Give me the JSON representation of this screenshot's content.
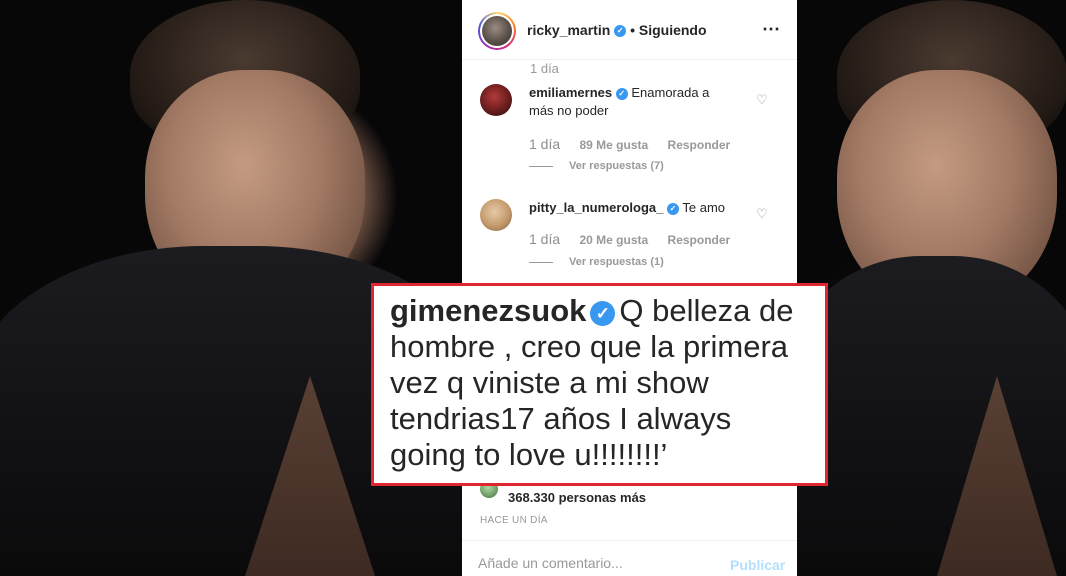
{
  "header": {
    "username": "ricky_martin",
    "separator": "•",
    "follow_state": "Siguiendo",
    "more_icon": "⋯"
  },
  "faded_time": "1 día",
  "comments": [
    {
      "username": "emiliamernes",
      "text": "Enamorada a más no poder",
      "time": "1 día",
      "likes": "89 Me gusta",
      "reply": "Responder",
      "view_replies": "Ver respuestas (7)"
    },
    {
      "username": "pitty_la_numerologa_",
      "text": "Te amo",
      "time": "1 día",
      "likes": "20 Me gusta",
      "reply": "Responder",
      "view_replies": "Ver respuestas (1)"
    }
  ],
  "highlight": {
    "username": "gimenezsuok",
    "text": "Q belleza de hombre , creo que la primera vez q viniste a mi show tendrias17 años I always going to love u!!!!!!!!’"
  },
  "likes_summary": "368.330 personas más",
  "post_time": "HACE UN DÍA",
  "comment_box": {
    "placeholder": "Añade un comentario...",
    "publish_label": "Publicar"
  },
  "icons": {
    "verified": "✓",
    "heart": "♡"
  },
  "colors": {
    "verified_blue": "#3897f0",
    "callout_border": "#e0272f",
    "publish_disabled": "#b2dffc"
  }
}
